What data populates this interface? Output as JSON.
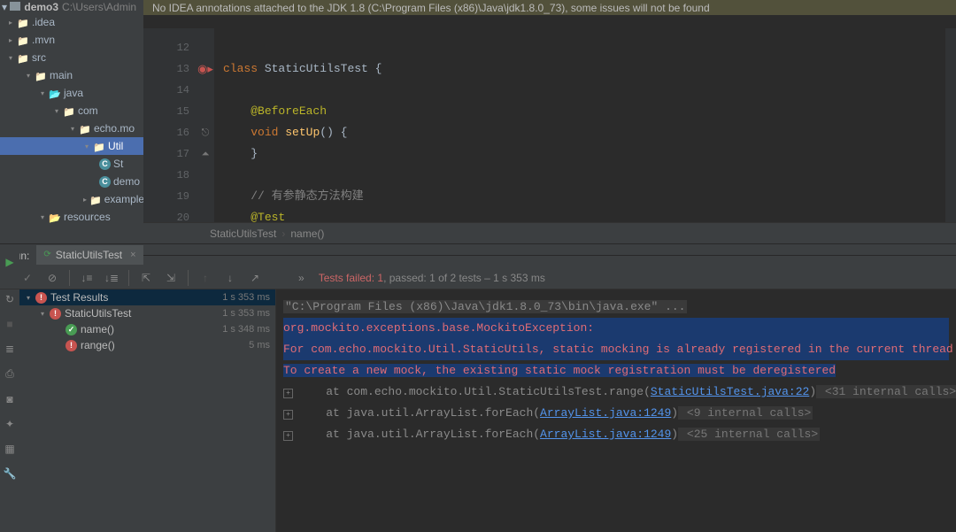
{
  "project": {
    "name": "demo3",
    "path": "C:\\Users\\Admin"
  },
  "warning": "No IDEA annotations attached to the JDK 1.8 (C:\\Program Files (x86)\\Java\\jdk1.8.0_73), some issues will not be found",
  "tree": {
    "idea": ".idea",
    "mvn": ".mvn",
    "src": "src",
    "main": "main",
    "java": "java",
    "com": "com",
    "echo": "echo.mo",
    "util": "Util",
    "st": "St",
    "demo": "demo",
    "example": "example",
    "resources": "resources"
  },
  "editor": {
    "lines": [
      "12",
      "13",
      "14",
      "15",
      "16",
      "17",
      "18",
      "19",
      "20"
    ],
    "kw_class": "class",
    "cls_name": "StaticUtilsTest {",
    "annot_before": "@BeforeEach",
    "kw_void": "void",
    "fn_setup": "setUp",
    "setup_rest": "() {",
    "brace_close": "}",
    "comment": "// 有参静态方法构建",
    "annot_test": "@Test"
  },
  "breadcrumb": {
    "a": "StaticUtilsTest",
    "b": "name()"
  },
  "run": {
    "label": "Run:",
    "tab": "StaticUtilsTest",
    "fail": "Tests failed: 1",
    "pass": ", passed: 1",
    "of": " of 2 tests",
    "time": " – 1 s 353 ms"
  },
  "tests": {
    "root": "Test Results",
    "root_time": "1 s 353 ms",
    "cls": "StaticUtilsTest",
    "cls_time": "1 s 353 ms",
    "t1": "name()",
    "t1_time": "1 s 348 ms",
    "t2": "range()",
    "t2_time": "5 ms"
  },
  "console": {
    "cmd": "\"C:\\Program Files (x86)\\Java\\jdk1.8.0_73\\bin\\java.exe\" ...",
    "exc": "org.mockito.exceptions.base.MockitoException:",
    "msg": "For com.echo.mockito.Util.StaticUtils, static mocking is already registered in the current thread",
    "hint": "To create a new mock, the existing static mock registration must be deregistered",
    "tr1_a": "    at com.echo.mockito.Util.StaticUtilsTest.range(",
    "tr1_link": "StaticUtilsTest.java:22",
    "tr1_b": ")",
    "tr1_int": " <31 internal calls>",
    "tr2_a": "    at java.util.ArrayList.forEach(",
    "tr2_link": "ArrayList.java:1249",
    "tr2_b": ")",
    "tr2_int": " <9 internal calls>",
    "tr3_a": "    at java.util.ArrayList.forEach(",
    "tr3_link": "ArrayList.java:1249",
    "tr3_b": ")",
    "tr3_int": " <25 internal calls>"
  }
}
